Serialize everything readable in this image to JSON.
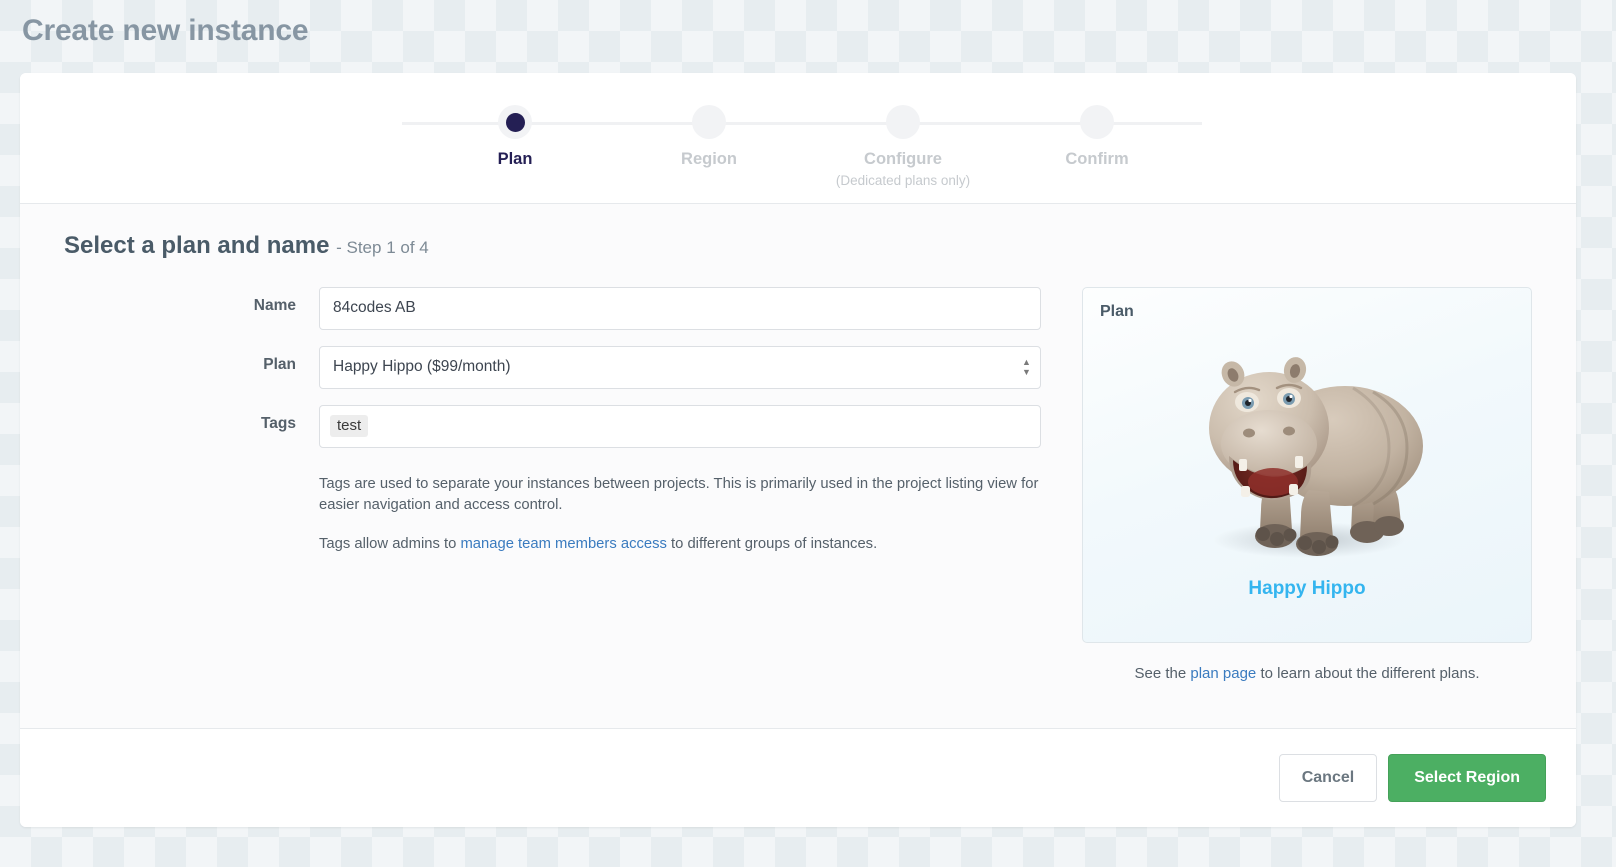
{
  "page": {
    "title": "Create new instance"
  },
  "stepper": {
    "steps": [
      {
        "label": "Plan",
        "sub": "",
        "active": true
      },
      {
        "label": "Region",
        "sub": "",
        "active": false
      },
      {
        "label": "Configure",
        "sub": "(Dedicated plans only)",
        "active": false
      },
      {
        "label": "Confirm",
        "sub": "",
        "active": false
      }
    ]
  },
  "section": {
    "title": "Select a plan and name",
    "step_of": "- Step 1 of 4"
  },
  "form": {
    "name": {
      "label": "Name",
      "value": "84codes AB",
      "placeholder": ""
    },
    "plan": {
      "label": "Plan",
      "value": "Happy Hippo ($99/month)",
      "options": [
        "Happy Hippo ($99/month)"
      ]
    },
    "tags": {
      "label": "Tags",
      "chips": [
        "test"
      ],
      "placeholder": ""
    },
    "helper": {
      "line1": "Tags are used to separate your instances between projects. This is primarily used in the project listing view for easier navigation and access control.",
      "line2_before": "Tags allow admins to ",
      "line2_link": "manage team members access",
      "line2_after": " to different groups of instances."
    }
  },
  "side": {
    "card_title": "Plan",
    "plan_name": "Happy Hippo",
    "plan_art_name": "hippo-illustration",
    "note_before": "See the ",
    "note_link": "plan page",
    "note_after": " to learn about the different plans."
  },
  "footer": {
    "cancel_label": "Cancel",
    "submit_label": "Select Region"
  },
  "colors": {
    "accent_green": "#4caf63",
    "accent_blue": "#34b5ef",
    "link_blue": "#3a7bbf",
    "active_step": "#241f54"
  }
}
